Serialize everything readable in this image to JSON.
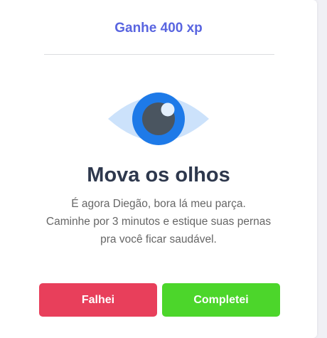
{
  "challenge": {
    "xp_label": "Ganhe 400 xp",
    "icon": "eye-icon",
    "title": "Mova os olhos",
    "description_lines": [
      "É agora Diegão, bora lá meu parça.",
      "Caminhe por 3 minutos e estique suas pernas",
      "pra você ficar saudável."
    ]
  },
  "actions": {
    "fail_label": "Falhei",
    "complete_label": "Completei"
  },
  "colors": {
    "accent": "#5965e0",
    "title": "#2e384d",
    "fail": "#e83f5b",
    "success": "#4cd62b",
    "eye_iris": "#1e7ae8"
  }
}
